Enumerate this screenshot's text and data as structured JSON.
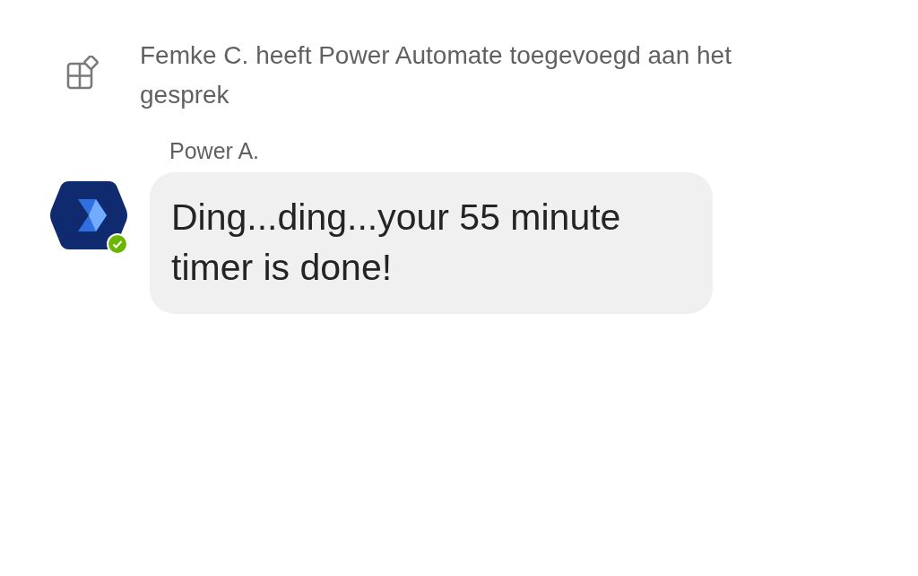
{
  "system_message": {
    "text": "Femke C. heeft Power Automate toegevoegd aan het gesprek"
  },
  "messages": [
    {
      "sender": "Power A.",
      "online": true,
      "text": "Ding...ding...your 55 minute timer is done!"
    }
  ]
}
